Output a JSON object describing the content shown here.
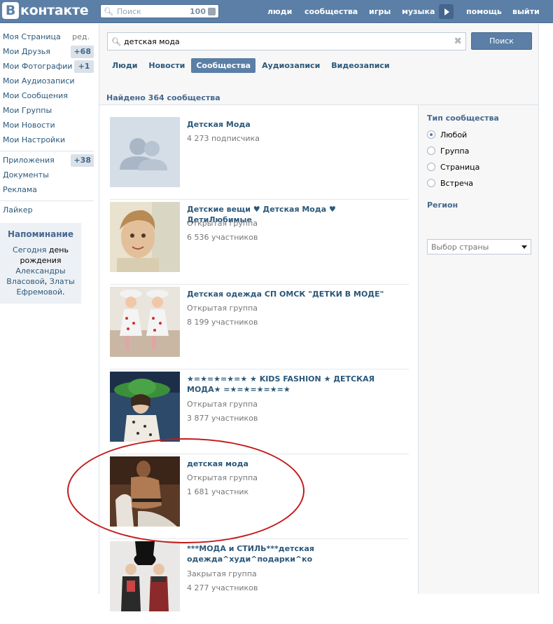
{
  "header": {
    "logo_b": "В",
    "logo_text": "контакте",
    "search_placeholder": "Поиск",
    "search_count": "100",
    "nav": [
      "люди",
      "сообщества",
      "игры",
      "музыка",
      "помощь",
      "выйти"
    ]
  },
  "sidebar": {
    "items": [
      {
        "label": "Моя Страница",
        "extra": "ред."
      },
      {
        "label": "Мои Друзья",
        "badge": "+68"
      },
      {
        "label": "Мои Фотографии",
        "badge": "+1"
      },
      {
        "label": "Мои Аудиозаписи"
      },
      {
        "label": "Мои Сообщения"
      },
      {
        "label": "Мои Группы"
      },
      {
        "label": "Мои Новости"
      },
      {
        "label": "Мои Настройки"
      }
    ],
    "items2": [
      {
        "label": "Приложения",
        "badge": "+38"
      },
      {
        "label": "Документы"
      },
      {
        "label": "Реклама"
      }
    ],
    "items3": [
      {
        "label": "Лайкер"
      }
    ],
    "reminder": {
      "title": "Напоминание",
      "today": "Сегодня",
      "birthday": "день рождения",
      "name1": "Александры Власовой",
      "comma": ",",
      "name2": "Златы Ефремовой",
      "dot": "."
    }
  },
  "search": {
    "query": "детская мода",
    "button": "Поиск",
    "tabs": [
      "Люди",
      "Новости",
      "Сообщества",
      "Аудиозаписи",
      "Видеозаписи"
    ],
    "active_tab": 2,
    "found": "Найдено 364 сообщества"
  },
  "results": [
    {
      "name": "Детская Мода",
      "line1": "4 273 подписчика",
      "line2": ""
    },
    {
      "name": "Детские вещи ♥ Детская Мода ♥ ДетиЛюбимые",
      "line1": "Открытая группа",
      "line2": "6 536 участников"
    },
    {
      "name": "Детская одежда СП ОМСК \"ДЕТКИ В МОДЕ\"",
      "line1": "Открытая группа",
      "line2": "8 199 участников"
    },
    {
      "name": "★=★=★=★=★ ★ KIDS FASHION ★ ДЕТСКАЯ МОДА★ =★=★=★=★=★",
      "line1": "Открытая группа",
      "line2": "3 877 участников"
    },
    {
      "name": "детская мода",
      "line1": "Открытая группа",
      "line2": "1 681 участник"
    },
    {
      "name": "***МОДА и СТИЛЬ***детская одежда^худи^подарки^ко",
      "line1": "Закрытая группа",
      "line2": "4 277 участников"
    }
  ],
  "filters": {
    "type_title": "Тип сообщества",
    "types": [
      "Любой",
      "Группа",
      "Страница",
      "Встреча"
    ],
    "selected_type": 0,
    "region_title": "Регион",
    "region_placeholder": "Выбор страны"
  },
  "colors": {
    "brand": "#5b7fa6",
    "link": "#2b587a",
    "annotation_circle": "#c41a1a"
  }
}
